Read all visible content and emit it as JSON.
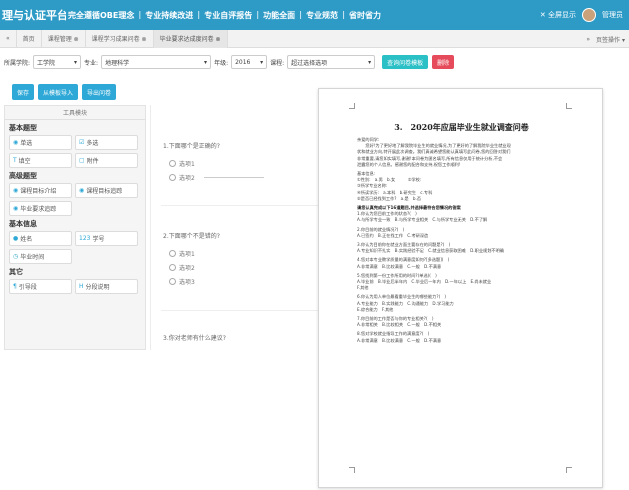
{
  "header": {
    "brand": "理与认证平台",
    "nav": [
      "完全遵循OBE理念",
      "专业持续改进",
      "专业自评报告",
      "功能全面",
      "专业规范",
      "省时省力"
    ],
    "fullscreen": "全屏显示",
    "username": "管理员"
  },
  "tabs": {
    "home": "首页",
    "items": [
      "课程管理 ⊗",
      "课程学习成果问卷 ⊗",
      "毕业要求达成度问卷 ⊗"
    ],
    "right_nav": "页签操作"
  },
  "filter": {
    "college_label": "所属学院:",
    "college_value": "工学院",
    "major_label": "专业:",
    "major_value": "地理科学",
    "grade_label": "年级:",
    "grade_value": "2016",
    "course_label": "课程:",
    "course_value": "超过选择选项",
    "query_button": "查询问卷模板",
    "delete_button": "删除"
  },
  "actions": [
    "保存",
    "从模板导入",
    "导出问卷"
  ],
  "toolbox": {
    "title": "工具模块",
    "sections": [
      {
        "name": "基本题型",
        "tools": [
          {
            "icon": "◉",
            "label": "单选"
          },
          {
            "icon": "☑",
            "label": "多选"
          },
          {
            "icon": "T",
            "label": "填空"
          },
          {
            "icon": "▢",
            "label": "附件"
          }
        ]
      },
      {
        "name": "高级题型",
        "tools": [
          {
            "icon": "◉",
            "label": "课程目标介绍"
          },
          {
            "icon": "◉",
            "label": "课程目标追踪"
          },
          {
            "icon": "◉",
            "label": "毕业要求追踪"
          }
        ]
      },
      {
        "name": "基本信息",
        "tools": [
          {
            "icon": "●",
            "label": "姓名"
          },
          {
            "icon": "123",
            "label": "学号"
          },
          {
            "icon": "◷",
            "label": "毕业时间"
          }
        ]
      },
      {
        "name": "其它",
        "tools": [
          {
            "icon": "¶",
            "label": "引导段"
          },
          {
            "icon": "H",
            "label": "分段说明"
          }
        ]
      }
    ]
  },
  "questions": [
    {
      "title": "1.下面哪个是正确的?",
      "options": [
        "选项1",
        "选项2"
      ]
    },
    {
      "title": "2.下面哪个不是错的?",
      "options": [
        "选项1",
        "选项2",
        "选项3"
      ]
    },
    {
      "title": "3.你对老师有什么建议?",
      "options": []
    }
  ],
  "document": {
    "title": "3.　2020年应届毕业生就业调查问卷",
    "lines": [
      {
        "bold": false,
        "text": "亲爱的同学:"
      },
      {
        "bold": false,
        "text": "　　您好!为了更好地了解我院毕业生的就业情况,为了更好的了解我院毕业生就业现"
      },
      {
        "bold": false,
        "text": "状和就业方向,特开展此次调查。我们真诚希望您能认真填写此问卷,您的回答对我们"
      },
      {
        "bold": false,
        "text": "非常重要,请您如实填写,谢谢!本问卷为匿名填写,所有信息仅用于统计分析,不会"
      },
      {
        "bold": false,
        "text": "泄露您的个人信息。感谢您的配合和支持,祝您工作顺利!"
      },
      {
        "bold": false,
        "text": ""
      },
      {
        "bold": false,
        "text": "基本信息:"
      },
      {
        "bold": false,
        "text": "①性别:　a.男　b.女　　　②学校:"
      },
      {
        "bold": false,
        "text": "③所学专业名称:"
      },
      {
        "bold": false,
        "text": "④所读学历:　a.本科　b.研究生　c.专科"
      },
      {
        "bold": false,
        "text": "⑤是否已经找到工作?　a.是　b.否"
      },
      {
        "bold": false,
        "text": ""
      },
      {
        "bold": true,
        "text": "请您认真完成以下16道题目,并选择最符合您情况的答案"
      },
      {
        "bold": false,
        "text": "1.你认为您目前工作的状态?(　)"
      },
      {
        "bold": false,
        "text": "A.与所学专业一致　B.与所学专业相关　C.与所学专业无关　D.不了解"
      },
      {
        "bold": false,
        "text": ""
      },
      {
        "bold": false,
        "text": "2.你目前的就业情况?(　)"
      },
      {
        "bold": false,
        "text": "A.已签约　B.正在找工作　C.考研深造"
      },
      {
        "bold": false,
        "text": ""
      },
      {
        "bold": false,
        "text": "3.你认为目前你在就业方面主要存在的问题是?(　)"
      },
      {
        "bold": false,
        "text": "A.专业知识不扎实　B.实践经验不足　C.就业信息获取困难　D.职业规划不明确"
      },
      {
        "bold": false,
        "text": ""
      },
      {
        "bold": false,
        "text": "4.您对本专业教学质量的满意度如何?[多选题](　)"
      },
      {
        "bold": false,
        "text": "A.非常满意　B.比较满意　C.一般　D.不满意"
      },
      {
        "bold": false,
        "text": ""
      },
      {
        "bold": false,
        "text": "5.您找到第一份工作所用的时间?(单选)(　)"
      },
      {
        "bold": false,
        "text": "A.毕业前　B.毕业后半年内　C.毕业后一年内　D.一年以上　E.尚未就业"
      },
      {
        "bold": false,
        "text": "F.其他"
      },
      {
        "bold": false,
        "text": ""
      },
      {
        "bold": false,
        "text": "6.你认为用人单位最看重毕业生的哪些能力?(　)"
      },
      {
        "bold": false,
        "text": "A.专业能力　B.实践能力　C.沟通能力　D.学习能力"
      },
      {
        "bold": false,
        "text": "E.综合能力　F.其他"
      },
      {
        "bold": false,
        "text": ""
      },
      {
        "bold": false,
        "text": "7.你目前的工作是否与你的专业相关?(　)"
      },
      {
        "bold": false,
        "text": "A.非常相关　B.比较相关　C.一般　D.不相关"
      },
      {
        "bold": false,
        "text": ""
      },
      {
        "bold": false,
        "text": "8.您对学校就业指导工作的满意度?(　)"
      },
      {
        "bold": false,
        "text": "A.非常满意　B.比较满意　C.一般　D.不满意"
      }
    ]
  },
  "colors": {
    "primary": "#2ea8d6",
    "header": "#2e9bc7",
    "danger": "#e64b5c",
    "teal": "#2bbfc6"
  }
}
